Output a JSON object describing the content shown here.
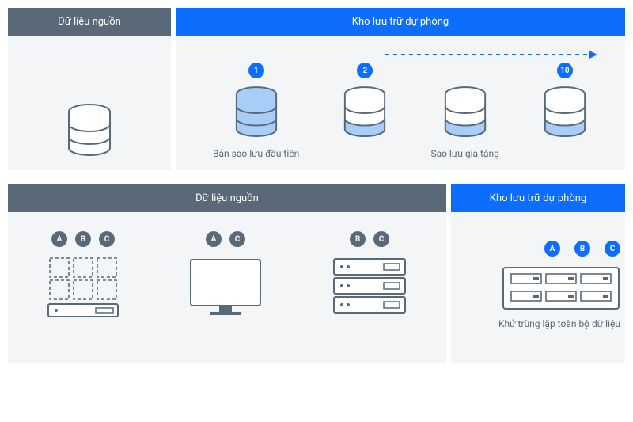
{
  "top": {
    "source_header": "Dữ liệu nguồn",
    "storage_header": "Kho lưu trữ dự phòng",
    "badges": {
      "b1": "1",
      "b2": "2",
      "b10": "10"
    },
    "caption_first": "Bản sao lưu đầu tiên",
    "caption_incr": "Sao lưu gia tăng"
  },
  "bottom": {
    "source_header": "Dữ liệu nguồn",
    "storage_header": "Kho lưu trữ dự phòng",
    "badge_a": "A",
    "badge_b": "B",
    "badge_c": "C",
    "caption_dedup": "Khử trùng lặp toàn bộ dữ liệu"
  }
}
